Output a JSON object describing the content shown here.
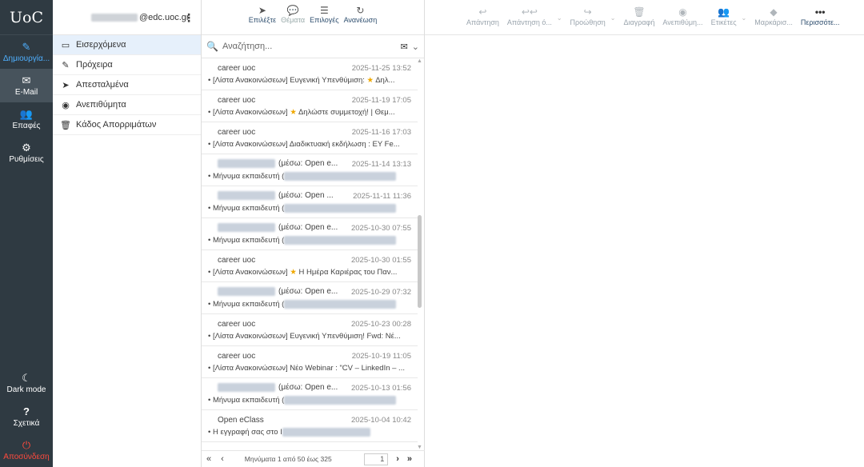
{
  "app": {
    "logo": "UoC"
  },
  "rail": {
    "compose": {
      "label": "Δημιουργία...",
      "icon": "compose-icon"
    },
    "mail": {
      "label": "E-Mail",
      "icon": "envelope-icon"
    },
    "contacts": {
      "label": "Επαφές",
      "icon": "contacts-icon"
    },
    "settings": {
      "label": "Ρυθμίσεις",
      "icon": "gear-icon"
    },
    "dark_mode": {
      "label": "Dark mode",
      "icon": "moon-icon"
    },
    "about": {
      "label": "Σχετικά",
      "icon": "question-icon"
    },
    "logout": {
      "label": "Αποσύνδεση",
      "icon": "power-icon"
    }
  },
  "account": {
    "email_suffix": "@edc.uoc.gr"
  },
  "folders": [
    {
      "label": "Εισερχόμενα",
      "icon": "inbox-icon"
    },
    {
      "label": "Πρόχειρα",
      "icon": "pencil-icon"
    },
    {
      "label": "Απεσταλμένα",
      "icon": "paper-plane-icon"
    },
    {
      "label": "Ανεπιθύμητα",
      "icon": "spam-icon"
    },
    {
      "label": "Κάδος Απορριμάτων",
      "icon": "trash-icon"
    }
  ],
  "list_toolbar": {
    "select": "Επιλέξτε",
    "threads": "Θέματα",
    "options": "Επιλογές",
    "refresh": "Ανανέωση"
  },
  "search": {
    "placeholder": "Αναζήτηση..."
  },
  "messages": [
    {
      "from": "career uoc",
      "date": "2025-11-25 13:52",
      "subject_pre": "[Λίστα Ανακοινώσεων] Ευγενική Υπενθύμιση: ",
      "star": true,
      "subject_post": " Δηλ..."
    },
    {
      "from": "career uoc",
      "date": "2025-11-19 17:05",
      "subject_pre": "[Λίστα Ανακοινώσεων] ",
      "star": true,
      "subject_post": " Δηλώστε συμμετοχή! | Θεμ..."
    },
    {
      "from": "career uoc",
      "date": "2025-11-16 17:03",
      "subject_pre": "[Λίστα Ανακοινώσεων] Διαδικτυακή εκδήλωση : EY Fe...",
      "star": false,
      "subject_post": ""
    },
    {
      "from": "(μέσω: Open e...",
      "date": "2025-11-14 13:13",
      "subject_pre": "Μήνυμα εκπαιδευτή (",
      "star": false,
      "subject_post": "",
      "blurred": true
    },
    {
      "from": "(μέσω: Open ...",
      "date": "2025-11-11 11:36",
      "subject_pre": "Μήνυμα εκπαιδευτή (",
      "star": false,
      "subject_post": "",
      "blurred": true
    },
    {
      "from": "(μέσω: Open e...",
      "date": "2025-10-30 07:55",
      "subject_pre": "Μήνυμα εκπαιδευτή (",
      "star": false,
      "subject_post": "",
      "blurred": true
    },
    {
      "from": "career uoc",
      "date": "2025-10-30 01:55",
      "subject_pre": "[Λίστα Ανακοινώσεων] ",
      "star": true,
      "subject_post": " Η Ημέρα Καριέρας του Παν..."
    },
    {
      "from": "(μέσω: Open e...",
      "date": "2025-10-29 07:32",
      "subject_pre": "Μήνυμα εκπαιδευτή (",
      "star": false,
      "subject_post": "",
      "blurred": true
    },
    {
      "from": "career uoc",
      "date": "2025-10-23 00:28",
      "subject_pre": "[Λίστα Ανακοινώσεων] Ευγενική Υπενθύμιση! Fwd: Νέ...",
      "star": false,
      "subject_post": ""
    },
    {
      "from": "career uoc",
      "date": "2025-10-19 11:05",
      "subject_pre": "[Λίστα Ανακοινώσεων] Νέο Webinar : \"CV – LinkedIn – ...",
      "star": false,
      "subject_post": ""
    },
    {
      "from": "(μέσω: Open e...",
      "date": "2025-10-13 01:56",
      "subject_pre": "Μήνυμα εκπαιδευτή (",
      "star": false,
      "subject_post": "",
      "blurred": true
    },
    {
      "from": "Open eClass",
      "date": "2025-10-04 10:42",
      "subject_pre": "Η εγγραφή σας στο Ι",
      "star": false,
      "subject_post": "",
      "blurred_sub": true
    }
  ],
  "pager": {
    "text": "Μηνύματα 1 από 50 έως 325",
    "page": "1"
  },
  "reader_toolbar": [
    {
      "label": "Απάντηση",
      "icon": "reply-icon"
    },
    {
      "label": "Απάντηση ό...",
      "icon": "reply-all-icon",
      "dropdown": true
    },
    {
      "label": "Προώθηση",
      "icon": "forward-icon",
      "dropdown": true
    },
    {
      "label": "Διαγραφή",
      "icon": "trash-icon"
    },
    {
      "label": "Ανεπιθύμη...",
      "icon": "spam-icon"
    },
    {
      "label": "Ετικέτες",
      "icon": "tags-icon",
      "dropdown": true
    },
    {
      "label": "Μαρκάρισ...",
      "icon": "tag-icon"
    },
    {
      "label": "Περισσότε...",
      "icon": "more-icon"
    }
  ]
}
